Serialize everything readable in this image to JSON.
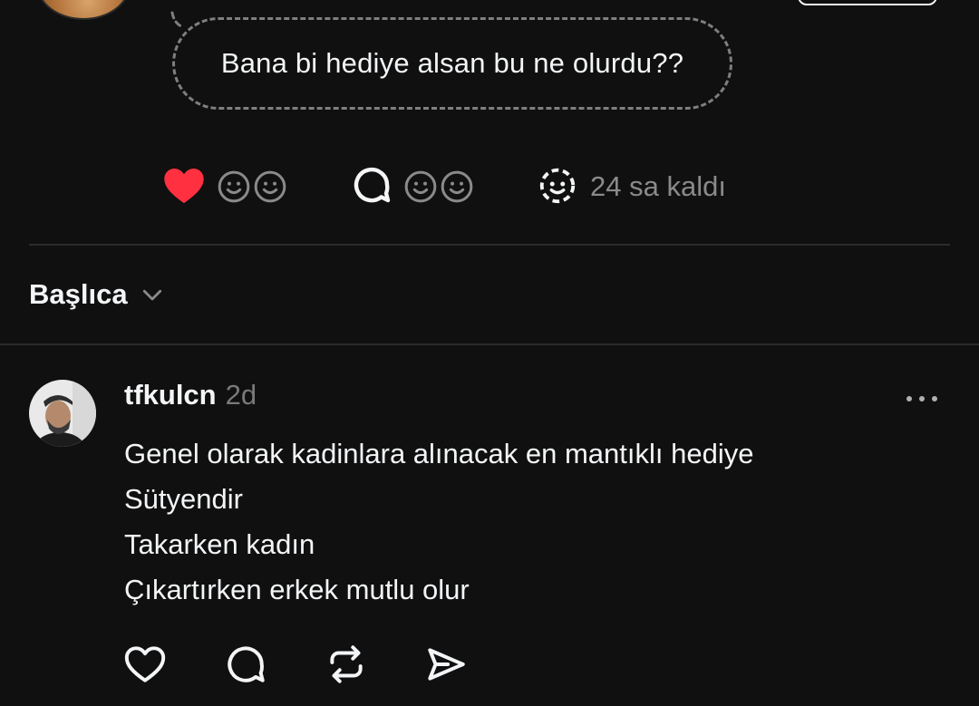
{
  "note": {
    "text": "Bana bi hediye alsan bu ne olurdu??"
  },
  "reactions": {
    "liked": true,
    "like_color": "#ff3040",
    "timer_text": "24 sa kaldı"
  },
  "filter": {
    "label": "Başlıca"
  },
  "comment": {
    "username": "tfkulcn",
    "time": "2d",
    "lines": [
      "Genel olarak kadinlara alınacak en mantıklı hediye",
      "Sütyendir",
      "Takarken kadın",
      "Çıkartırken erkek mutlu olur"
    ]
  },
  "icons": {
    "like": "heart-outline-icon",
    "reply": "comment-bubble-icon",
    "repost": "repost-icon",
    "share": "send-icon",
    "more": "more-dots-icon"
  }
}
